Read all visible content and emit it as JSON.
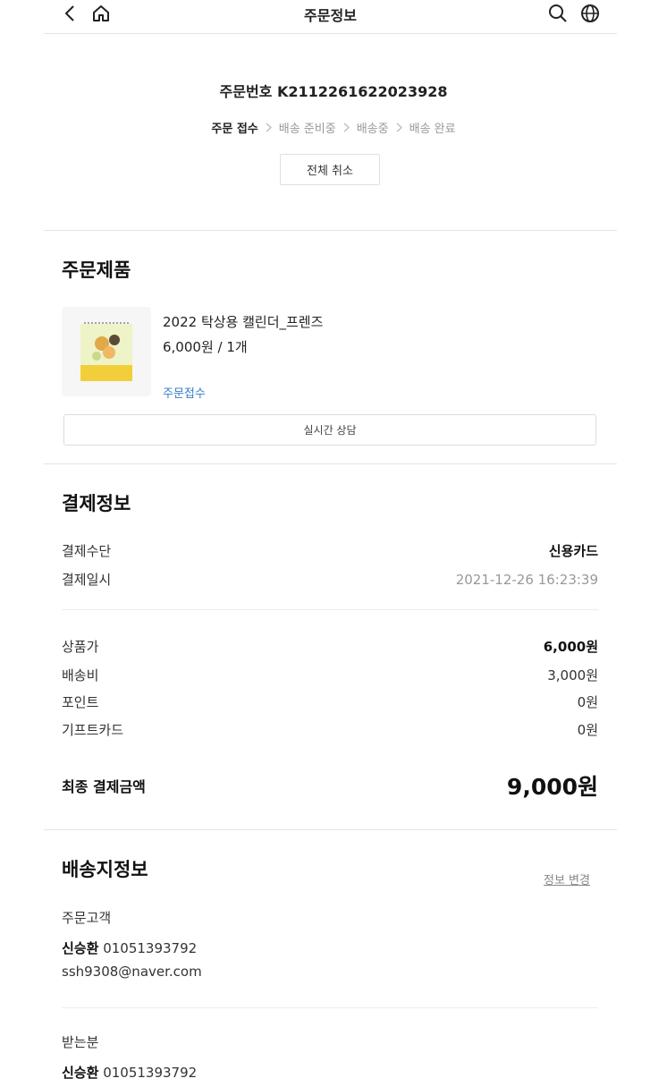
{
  "header": {
    "title": "주문정보",
    "icons": [
      "chevron-left-icon",
      "home-icon",
      "search-icon",
      "globe-icon"
    ]
  },
  "order": {
    "number_line": "주문번호 K2112261622023928",
    "steps": [
      {
        "label": "주문 접수",
        "active": true
      },
      {
        "label": "배송 준비중",
        "active": false
      },
      {
        "label": "배송중",
        "active": false
      },
      {
        "label": "배송 완료",
        "active": false
      }
    ],
    "cancel_label": "전체 취소"
  },
  "products": {
    "title": "주문제품",
    "item": {
      "name": "2022 탁상용 캘린더_프렌즈",
      "price_qty": "6,000원 / 1개",
      "status": "주문접수"
    },
    "chat_label": "실시간 상담"
  },
  "payment": {
    "title": "결제정보",
    "method_label": "결제수단",
    "method_value": "신용카드",
    "date_label": "결제일시",
    "date_value": "2021-12-26 16:23:39",
    "product_price_label": "상품가",
    "product_price_value": "6,000원",
    "shipping_label": "배송비",
    "shipping_value": "3,000원",
    "point_label": "포인트",
    "point_value": "0원",
    "giftcard_label": "기프트카드",
    "giftcard_value": "0원",
    "total_label": "최종 결제금액",
    "total_value": "9,000원"
  },
  "delivery": {
    "title": "배송지정보",
    "edit_label": "정보 변경",
    "customer_label": "주문고객",
    "customer_name": "신승환",
    "customer_phone": "01051393792",
    "customer_email": "ssh9308@naver.com",
    "recipient_label": "받는분",
    "recipient_name": "신승환",
    "recipient_phone": "01051393792"
  },
  "colors": {
    "accent_link": "#2f7fc4",
    "muted_text": "#999999",
    "divider": "#e4e4e4"
  }
}
